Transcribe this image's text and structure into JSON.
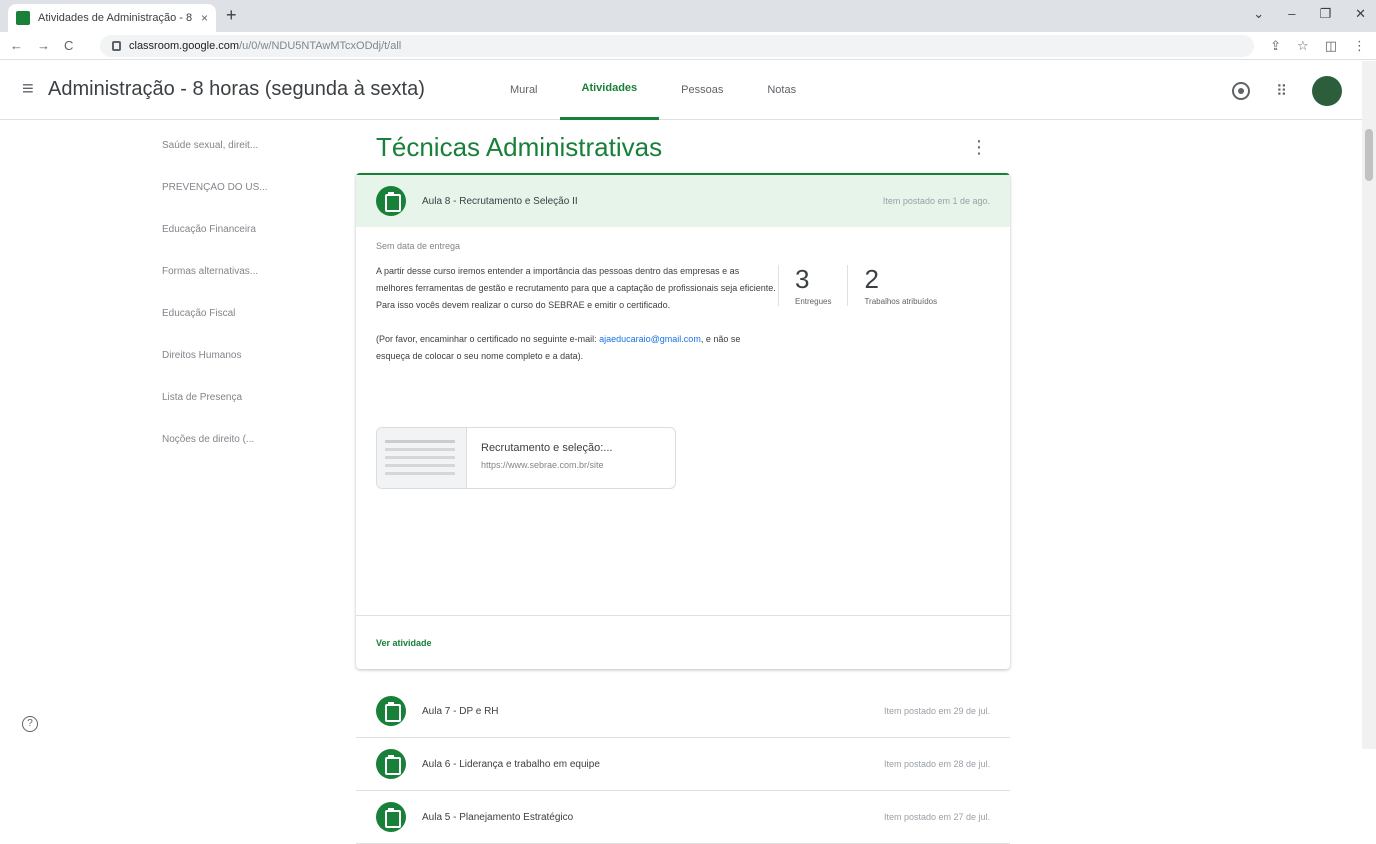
{
  "browser": {
    "tab_title": "Atividades de Administração - 8",
    "tab_close": "×",
    "new_tab": "+",
    "win_min": "⌄",
    "win_minimize": "–",
    "win_restore": "❐",
    "win_close": "✕",
    "back": "←",
    "forward": "→",
    "reload": "C",
    "url_host": "classroom.google.com",
    "url_path": "/u/0/w/NDU5NTAwMTcxODdj/t/all",
    "share": "⇪",
    "star": "☆",
    "sidepanel": "◫",
    "more": "⋮"
  },
  "header": {
    "menu": "≡",
    "class_name": "Administração - 8 horas (segunda à sexta)",
    "tabs": [
      {
        "label": "Mural"
      },
      {
        "label": "Atividades"
      },
      {
        "label": "Pessoas"
      },
      {
        "label": "Notas"
      }
    ],
    "apps": "⠿"
  },
  "topics": [
    "Saúde sexual, direit...",
    "PREVENÇÃO DO US...",
    "Educação Financeira",
    "Formas alternativas...",
    "Educação Fiscal",
    "Direitos Humanos",
    "Lista de Presença",
    "Noções de direito (..."
  ],
  "section": {
    "title": "Técnicas Administrativas",
    "kebab": "⋮"
  },
  "expanded": {
    "title": "Aula 8 - Recrutamento e Seleção II",
    "date": "Item postado em 1 de ago.",
    "due": "Sem data de entrega",
    "desc1": "A partir desse curso iremos entender a importância das pessoas dentro das empresas e as melhores ferramentas de gestão e recrutamento para que a captação de profissionais seja eficiente. Para isso vocês devem realizar o curso do SEBRAE e emitir o certificado.",
    "desc2_a": "(Por favor, encaminhar o certificado no seguinte e-mail: ",
    "desc2_mail": "ajaeducaraio@gmail.com",
    "desc2_b": ", e não se esqueça de colocar o seu nome completo e a data).",
    "stat1_num": "3",
    "stat1_label": "Entregues",
    "stat2_num": "2",
    "stat2_label": "Trabalhos atribuídos",
    "attachment_title": "Recrutamento e seleção:...",
    "attachment_url": "https://www.sebrae.com.br/site",
    "see_link": "Ver atividade"
  },
  "items": [
    {
      "title": "Aula 7 - DP e RH",
      "date": "Item postado em 29 de jul."
    },
    {
      "title": "Aula 6 - Liderança e trabalho em equipe",
      "date": "Item postado em 28 de jul."
    },
    {
      "title": "Aula 5 - Planejamento Estratégico",
      "date": "Item postado em 27 de jul."
    }
  ],
  "help": "?",
  "colors": {
    "accent": "#188038",
    "accent_light": "#e6f4ea",
    "link": "#1a73e8"
  }
}
